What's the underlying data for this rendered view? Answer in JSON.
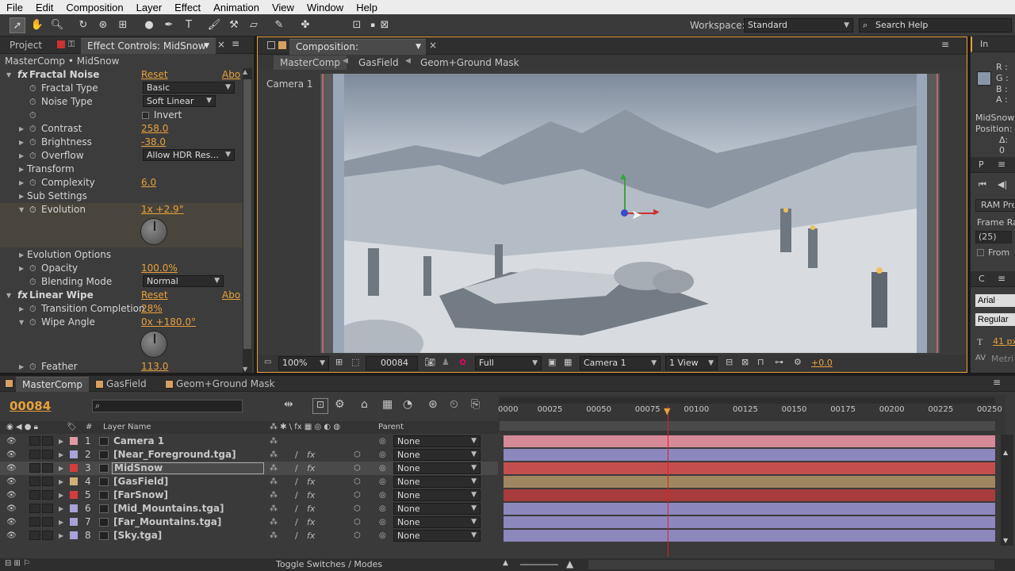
{
  "menu": [
    "File",
    "Edit",
    "Composition",
    "Layer",
    "Effect",
    "Animation",
    "View",
    "Window",
    "Help"
  ],
  "toolbar": {
    "workspace_label": "Workspace:",
    "workspace_value": "Standard",
    "search_placeholder": "Search Help"
  },
  "left_panel": {
    "tab_project": "Project",
    "tab_effect_controls": "Effect Controls: MidSnow",
    "breadcrumb": "MasterComp • MidSnow",
    "reset": "Reset",
    "about": "Abo",
    "effects": {
      "fractal_noise": {
        "name": "Fractal Noise",
        "fractal_type_label": "Fractal Type",
        "fractal_type_value": "Basic",
        "noise_type_label": "Noise Type",
        "noise_type_value": "Soft Linear",
        "invert_label": "Invert",
        "contrast_label": "Contrast",
        "contrast_value": "258.0",
        "brightness_label": "Brightness",
        "brightness_value": "-38.0",
        "overflow_label": "Overflow",
        "overflow_value": "Allow HDR Res...",
        "transform_label": "Transform",
        "complexity_label": "Complexity",
        "complexity_value": "6.0",
        "sub_settings_label": "Sub Settings",
        "evolution_label": "Evolution",
        "evolution_value": "1x +2.9°",
        "evolution_options_label": "Evolution Options",
        "opacity_label": "Opacity",
        "opacity_value": "100.0%",
        "blending_mode_label": "Blending Mode",
        "blending_mode_value": "Normal"
      },
      "linear_wipe": {
        "name": "Linear Wipe",
        "transition_label": "Transition Completion",
        "transition_value": "28%",
        "wipe_angle_label": "Wipe Angle",
        "wipe_angle_value": "0x +180.0°",
        "feather_label": "Feather",
        "feather_value": "113.0"
      }
    }
  },
  "composition": {
    "tab": "Composition: MasterComp",
    "breadcrumbs": [
      "MasterComp",
      "GasField",
      "Geom+Ground Mask"
    ],
    "camera_label": "Camera 1",
    "footer": {
      "zoom": "100%",
      "timecode": "00084",
      "resolution": "Full",
      "camera": "Camera 1",
      "view": "1 View",
      "exposure": "+0.0"
    }
  },
  "info_panel": {
    "title": "In",
    "r": "R :",
    "g": "G :",
    "b": "B :",
    "a": "A :",
    "layer": "MidSnow",
    "position": "Position:",
    "delta": "Δ: 0",
    "preview_tab": "P",
    "ram_preview": "RAM Pre",
    "frame_rate_label": "Frame Ra",
    "frame_rate_value": "(25)",
    "from_label": "From",
    "char_tab": "C",
    "font": "Arial",
    "style": "Regular",
    "size": "41 px",
    "metrics": "Metri"
  },
  "timeline": {
    "tabs": [
      "MasterComp",
      "GasField",
      "Geom+Ground Mask"
    ],
    "timecode": "00084",
    "col_layer_name": "Layer Name",
    "col_parent": "Parent",
    "col_hash": "#",
    "ticks": [
      "0000",
      "00025",
      "00050",
      "00075",
      "00100",
      "00125",
      "00150",
      "00175",
      "00200",
      "00225",
      "00250"
    ],
    "toggle_label": "Toggle Switches / Modes",
    "layers": [
      {
        "num": "1",
        "name": "Camera 1",
        "parent": "None",
        "color": "#e29aa5",
        "bar": "#d58a97"
      },
      {
        "num": "2",
        "name": "[Near_Foreground.tga]",
        "parent": "None",
        "color": "#a7a3d6",
        "bar": "#8c87bd"
      },
      {
        "num": "3",
        "name": "MidSnow",
        "parent": "None",
        "color": "#d33d3d",
        "bar": "#c44e4e"
      },
      {
        "num": "4",
        "name": "[GasField]",
        "parent": "None",
        "color": "#d1b07a",
        "bar": "#a08660"
      },
      {
        "num": "5",
        "name": "[FarSnow]",
        "parent": "None",
        "color": "#d33d3d",
        "bar": "#a83b3b"
      },
      {
        "num": "6",
        "name": "[Mid_Mountains.tga]",
        "parent": "None",
        "color": "#a7a3d6",
        "bar": "#8c87bd"
      },
      {
        "num": "7",
        "name": "[Far_Mountains.tga]",
        "parent": "None",
        "color": "#a7a3d6",
        "bar": "#8c87bd"
      },
      {
        "num": "8",
        "name": "[Sky.tga]",
        "parent": "None",
        "color": "#a7a3d6",
        "bar": "#8c87bd"
      }
    ]
  }
}
